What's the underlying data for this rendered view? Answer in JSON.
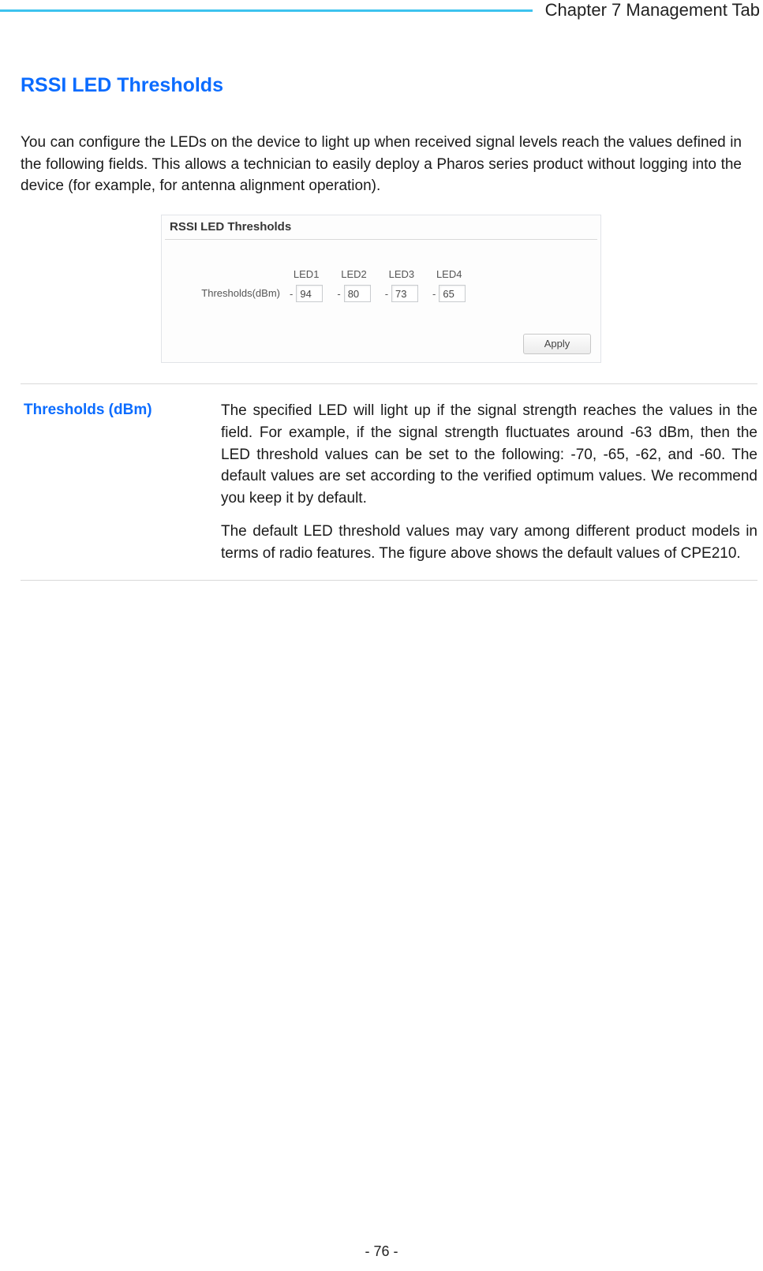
{
  "header": {
    "chapter": "Chapter 7 Management Tab"
  },
  "section_title": "RSSI LED Thresholds",
  "intro_text": "You can configure the LEDs on the device to light up when received signal levels reach the values defined in the following fields. This allows a technician to easily deploy a Pharos series product without logging into the device (for example, for antenna alignment operation).",
  "panel": {
    "title": "RSSI LED Thresholds",
    "row_label": "Thresholds(dBm)",
    "minus_sign": "-",
    "leds": [
      {
        "label": "LED1",
        "value": "94"
      },
      {
        "label": "LED2",
        "value": "80"
      },
      {
        "label": "LED3",
        "value": "73"
      },
      {
        "label": "LED4",
        "value": "65"
      }
    ],
    "apply_label": "Apply"
  },
  "definition": {
    "term": "Thresholds (dBm)",
    "p1": "The specified LED will light up if the signal strength reaches the values in the field. For example, if the signal strength fluctuates around -63 dBm, then the LED threshold values can be set to the following: -70, -65, -62, and -60. The default values are set according to the verified optimum values. We recommend you keep it by default.",
    "p2": "The default LED threshold values may vary among different product models in terms of radio features. The figure above shows the default values of CPE210."
  },
  "page_number": "- 76 -"
}
